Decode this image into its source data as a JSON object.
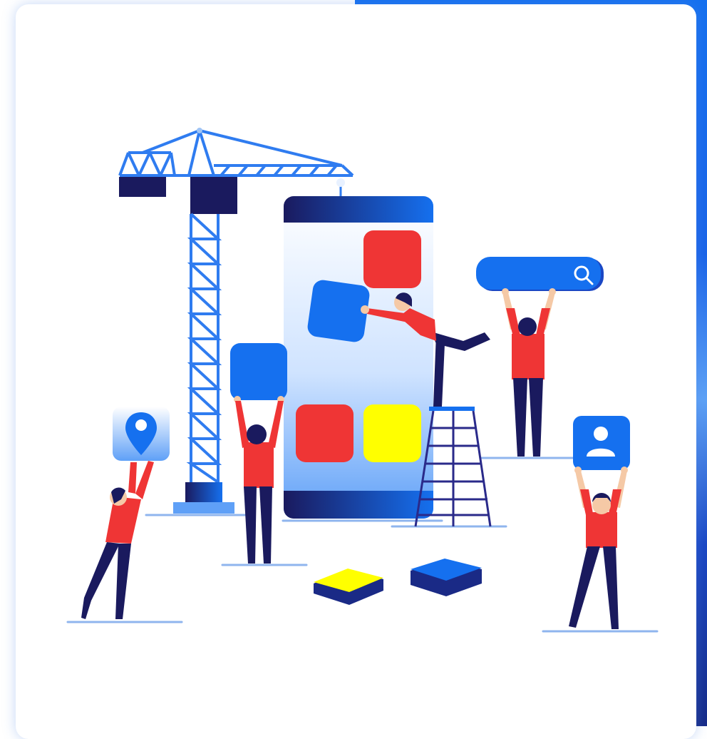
{
  "illustration": {
    "theme": "app development construction",
    "icons": [
      "crane",
      "map-pin-icon",
      "search-icon",
      "user-icon",
      "ladder",
      "phone-mockup"
    ],
    "colors": {
      "primary_blue": "#1570ef",
      "dark_navy": "#1a1a5e",
      "red": "#ef3535",
      "yellow": "#ffff00",
      "skin": "#f5c9a6",
      "ground_line": "#8fb5ee"
    }
  }
}
